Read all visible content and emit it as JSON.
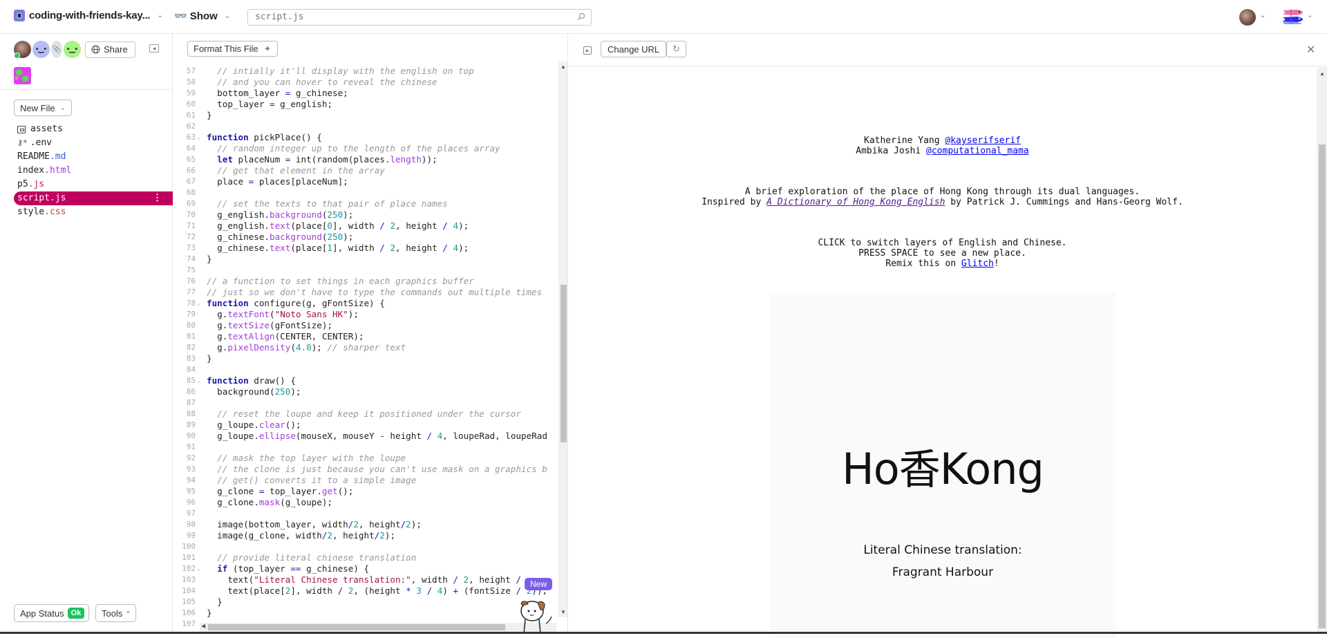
{
  "topbar": {
    "project_name": "coding-with-friends-kay...",
    "show_label": "Show",
    "search_placeholder": "script.js",
    "colors": {
      "project_logo": "#8d6fe8"
    }
  },
  "sidebar": {
    "share_label": "Share",
    "new_file_label": "New File",
    "files": [
      {
        "name": "assets",
        "ext": "",
        "type": "folder"
      },
      {
        "name": ".env",
        "ext": "",
        "type": "env"
      },
      {
        "name": "README",
        "ext": ".md",
        "type": "file"
      },
      {
        "name": "index",
        "ext": ".html",
        "type": "file"
      },
      {
        "name": "p5",
        "ext": ".js",
        "type": "file"
      },
      {
        "name": "script",
        "ext": ".js",
        "type": "file",
        "active": true
      },
      {
        "name": "style",
        "ext": ".css",
        "type": "file"
      }
    ],
    "kebab": "⋮",
    "app_status_label": "App Status",
    "app_status_value": "Ok",
    "tools_label": "Tools",
    "colors": {
      "active_file": "#c0005f",
      "status_ok": "#1ec260"
    }
  },
  "editor": {
    "format_label": "Format This File",
    "new_badge": "New",
    "lines": [
      {
        "n": "57",
        "html": "  <span class='cm'>// intially it'll display with the english on top</span>"
      },
      {
        "n": "58",
        "html": "  <span class='cm'>// and you can hover to reveal the chinese</span>"
      },
      {
        "n": "59",
        "html": "  bottom_layer <span class='op'>=</span> g_chinese;"
      },
      {
        "n": "60",
        "html": "  top_layer <span class='op'>=</span> g_english;"
      },
      {
        "n": "61",
        "html": "}"
      },
      {
        "n": "62",
        "html": ""
      },
      {
        "n": "63",
        "fold": true,
        "html": "<span class='kw'>function</span> pickPlace() {"
      },
      {
        "n": "64",
        "html": "  <span class='cm'>// random integer up to the length of the places array</span>"
      },
      {
        "n": "65",
        "html": "  <span class='kw'>let</span> placeNum <span class='op'>=</span> int(random(places.<span class='fn'>length</span>));"
      },
      {
        "n": "66",
        "html": "  <span class='cm'>// get that element in the array</span>"
      },
      {
        "n": "67",
        "html": "  place <span class='op'>=</span> places[placeNum];"
      },
      {
        "n": "68",
        "html": ""
      },
      {
        "n": "69",
        "html": "  <span class='cm'>// set the texts to that pair of place names</span>"
      },
      {
        "n": "70",
        "html": "  g_english.<span class='fn'>background</span>(<span class='num'>250</span>);"
      },
      {
        "n": "71",
        "html": "  g_english.<span class='fn'>text</span>(place[<span class='num'>0</span>], width <span class='op'>/</span> <span class='num'>2</span>, height <span class='op'>/</span> <span class='num'>4</span>);"
      },
      {
        "n": "72",
        "html": "  g_chinese.<span class='fn'>background</span>(<span class='num'>250</span>);"
      },
      {
        "n": "73",
        "html": "  g_chinese.<span class='fn'>text</span>(place[<span class='num'>1</span>], width <span class='op'>/</span> <span class='num'>2</span>, height <span class='op'>/</span> <span class='num'>4</span>);"
      },
      {
        "n": "74",
        "html": "}"
      },
      {
        "n": "75",
        "html": ""
      },
      {
        "n": "76",
        "html": "<span class='cm'>// a function to set things in each graphics buffer</span>"
      },
      {
        "n": "77",
        "html": "<span class='cm'>// just so we don't have to type the commands out multiple times</span>"
      },
      {
        "n": "78",
        "fold": true,
        "html": "<span class='kw'>function</span> configure(g, gFontSize) {"
      },
      {
        "n": "79",
        "html": "  g.<span class='fn'>textFont</span>(<span class='str'>\"Noto Sans HK\"</span>);"
      },
      {
        "n": "80",
        "html": "  g.<span class='fn'>textSize</span>(gFontSize);"
      },
      {
        "n": "81",
        "html": "  g.<span class='fn'>textAlign</span>(CENTER, CENTER);"
      },
      {
        "n": "82",
        "html": "  g.<span class='fn'>pixelDensity</span>(<span class='num'>4.0</span>); <span class='cm'>// sharper text</span>"
      },
      {
        "n": "83",
        "html": "}"
      },
      {
        "n": "84",
        "html": ""
      },
      {
        "n": "85",
        "fold": true,
        "html": "<span class='kw'>function</span> draw() {"
      },
      {
        "n": "86",
        "html": "  background(<span class='num'>250</span>);"
      },
      {
        "n": "87",
        "html": ""
      },
      {
        "n": "88",
        "html": "  <span class='cm'>// reset the loupe and keep it positioned under the cursor</span>"
      },
      {
        "n": "89",
        "html": "  g_loupe.<span class='fn'>clear</span>();"
      },
      {
        "n": "90",
        "html": "  g_loupe.<span class='fn'>ellipse</span>(mouseX, mouseY <span class='op'>-</span> height <span class='op'>/</span> <span class='num'>4</span>, loupeRad, loupeRad"
      },
      {
        "n": "91",
        "html": ""
      },
      {
        "n": "92",
        "html": "  <span class='cm'>// mask the top layer with the loupe</span>"
      },
      {
        "n": "93",
        "html": "  <span class='cm'>// the clone is just because you can't use mask on a graphics b</span>"
      },
      {
        "n": "94",
        "html": "  <span class='cm'>// get() converts it to a simple image</span>"
      },
      {
        "n": "95",
        "html": "  g_clone <span class='op'>=</span> top_layer.<span class='fn'>get</span>();"
      },
      {
        "n": "96",
        "html": "  g_clone.<span class='fn'>mask</span>(g_loupe);"
      },
      {
        "n": "97",
        "html": ""
      },
      {
        "n": "98",
        "html": "  image(bottom_layer, width<span class='op'>/</span><span class='num'>2</span>, height<span class='op'>/</span><span class='num'>2</span>);"
      },
      {
        "n": "99",
        "html": "  image(g_clone, width<span class='op'>/</span><span class='num'>2</span>, height<span class='op'>/</span><span class='num'>2</span>);"
      },
      {
        "n": "100",
        "html": ""
      },
      {
        "n": "101",
        "html": "  <span class='cm'>// provide literal chinese translation</span>"
      },
      {
        "n": "102",
        "fold": true,
        "html": "  <span class='kw'>if</span> (top_layer <span class='op'>==</span> g_chinese) {"
      },
      {
        "n": "103",
        "html": "    text(<span class='str'>\"Literal Chinese translation:\"</span>, width <span class='op'>/</span> <span class='num'>2</span>, height <span class='op'>/</span>"
      },
      {
        "n": "104",
        "html": "    text(place[<span class='num'>2</span>], width <span class='op'>/</span> <span class='num'>2</span>, (height <span class='op'>*</span> <span class='num'>3</span> <span class='op'>/</span> <span class='num'>4</span>) <span class='op'>+</span> (fontSize <span class='op'>/</span> <span class='num'>2</span>));"
      },
      {
        "n": "105",
        "html": "  }"
      },
      {
        "n": "106",
        "html": "}"
      },
      {
        "n": "107",
        "html": ""
      }
    ]
  },
  "preview": {
    "change_url_label": "Change URL",
    "credits": [
      {
        "name": "Katherine Yang",
        "handle": "@kayserifserif"
      },
      {
        "name": "Ambika Joshi",
        "handle": "@computational_mama"
      }
    ],
    "about_line1": "A brief exploration of the place of Hong Kong through its dual languages.",
    "about_prefix": "Inspired by",
    "about_book": "A Dictionary of Hong Kong English",
    "about_suffix": "by Patrick J. Cummings and Hans-Georg Wolf.",
    "instr_line1": "CLICK to switch layers of English and Chinese.",
    "instr_line2": "PRESS SPACE to see a new place.",
    "remix_prefix": "Remix this on",
    "remix_link": "Glitch",
    "remix_suffix": "!",
    "canvas": {
      "english_left": "Ho",
      "chinese_char": "香",
      "english_right": "Kong",
      "literal_label": "Literal Chinese translation:",
      "literal_value": "Fragrant Harbour"
    }
  }
}
